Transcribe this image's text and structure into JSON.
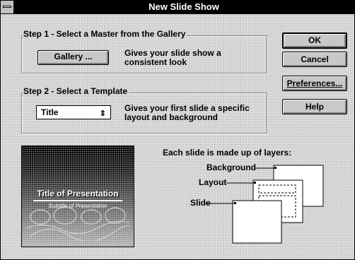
{
  "window": {
    "title": "New Slide Show"
  },
  "step1": {
    "label": "Step 1 - Select a Master from the Gallery",
    "button_label": "Gallery ...",
    "description": [
      "Gives your slide show a",
      "consistent look"
    ]
  },
  "step2": {
    "label": "Step 2 - Select a Template",
    "template_value": "Title",
    "description": [
      "Gives your first slide a specific",
      "layout and background"
    ]
  },
  "buttons": {
    "ok": "OK",
    "cancel": "Cancel",
    "preferences": "Preferences...",
    "help": "Help"
  },
  "preview": {
    "title": "Title of Presentation",
    "subtitle": "Subtitle of Presentation"
  },
  "layers": {
    "caption": "Each slide is made up of layers:",
    "background": "Background",
    "layout": "Layout",
    "slide": "Slide"
  },
  "icons": {
    "system_menu": "system-menu-icon",
    "dropdown": "updown-arrow-icon"
  }
}
